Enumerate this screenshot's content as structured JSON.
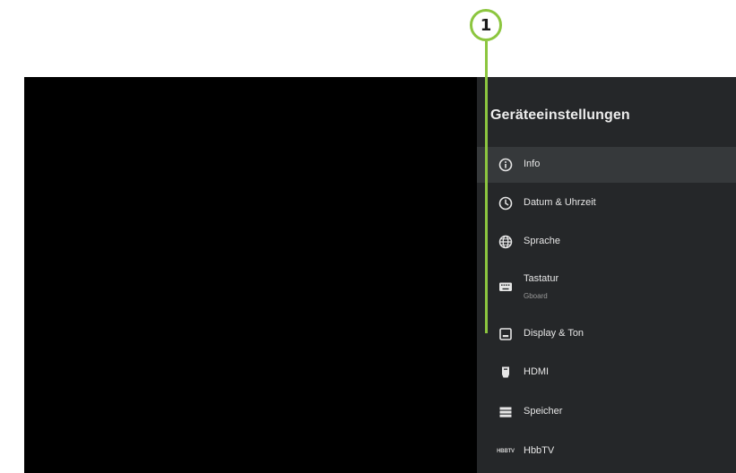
{
  "callout": {
    "number": "1",
    "color": "#8cc63f"
  },
  "panel": {
    "title": "Geräteeinstellungen",
    "items": [
      {
        "label": "Info",
        "icon": "info-icon",
        "selected": true
      },
      {
        "label": "Datum & Uhrzeit",
        "icon": "clock-icon"
      },
      {
        "label": "Sprache",
        "icon": "globe-icon"
      },
      {
        "label": "Tastatur",
        "sublabel": "Gboard",
        "icon": "keyboard-icon"
      },
      {
        "label": "Display & Ton",
        "icon": "display-icon"
      },
      {
        "label": "HDMI",
        "icon": "hdmi-icon"
      },
      {
        "label": "Speicher",
        "icon": "storage-icon"
      },
      {
        "label": "HbbTV",
        "icon": "hbbtv-icon",
        "icon_text": "HBBTV"
      }
    ]
  }
}
